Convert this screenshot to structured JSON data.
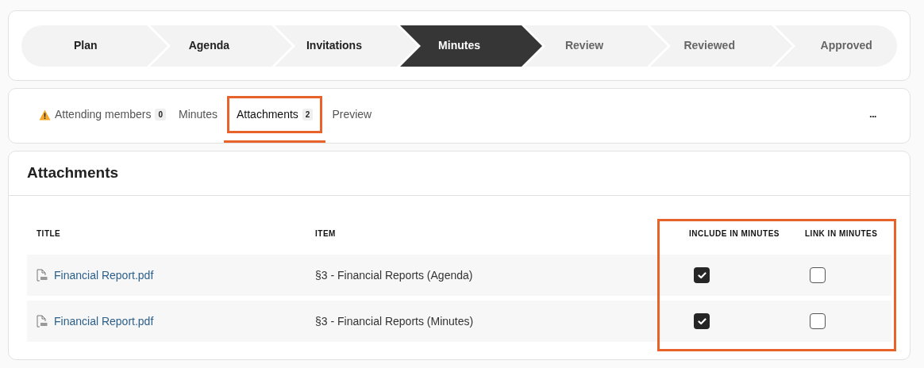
{
  "steps": [
    {
      "label": "Plan",
      "completed": true,
      "selected": false
    },
    {
      "label": "Agenda",
      "completed": true,
      "selected": false
    },
    {
      "label": "Invitations",
      "completed": true,
      "selected": false
    },
    {
      "label": "Minutes",
      "completed": false,
      "selected": true
    },
    {
      "label": "Review",
      "completed": false,
      "selected": false
    },
    {
      "label": "Reviewed",
      "completed": false,
      "selected": false
    },
    {
      "label": "Approved",
      "completed": false,
      "selected": false
    }
  ],
  "tabs": [
    {
      "label": "Attending members",
      "count": "0",
      "warning": true,
      "selected": false
    },
    {
      "label": "Minutes",
      "warning": false,
      "selected": false
    },
    {
      "label": "Attachments",
      "count": "2",
      "warning": false,
      "selected": true
    },
    {
      "label": "Preview",
      "warning": false,
      "selected": false
    }
  ],
  "more_menu": "•••",
  "section": {
    "title": "Attachments"
  },
  "table": {
    "columns": [
      "TITLE",
      "ITEM",
      "INCLUDE IN MINUTES",
      "LINK IN MINUTES"
    ],
    "rows": [
      {
        "title": "Financial Report.pdf",
        "item": "§3 - Financial Reports (Agenda)",
        "include": true,
        "link": false
      },
      {
        "title": "Financial Report.pdf",
        "item": "§3 - Financial Reports (Minutes)",
        "include": true,
        "link": false
      }
    ]
  }
}
